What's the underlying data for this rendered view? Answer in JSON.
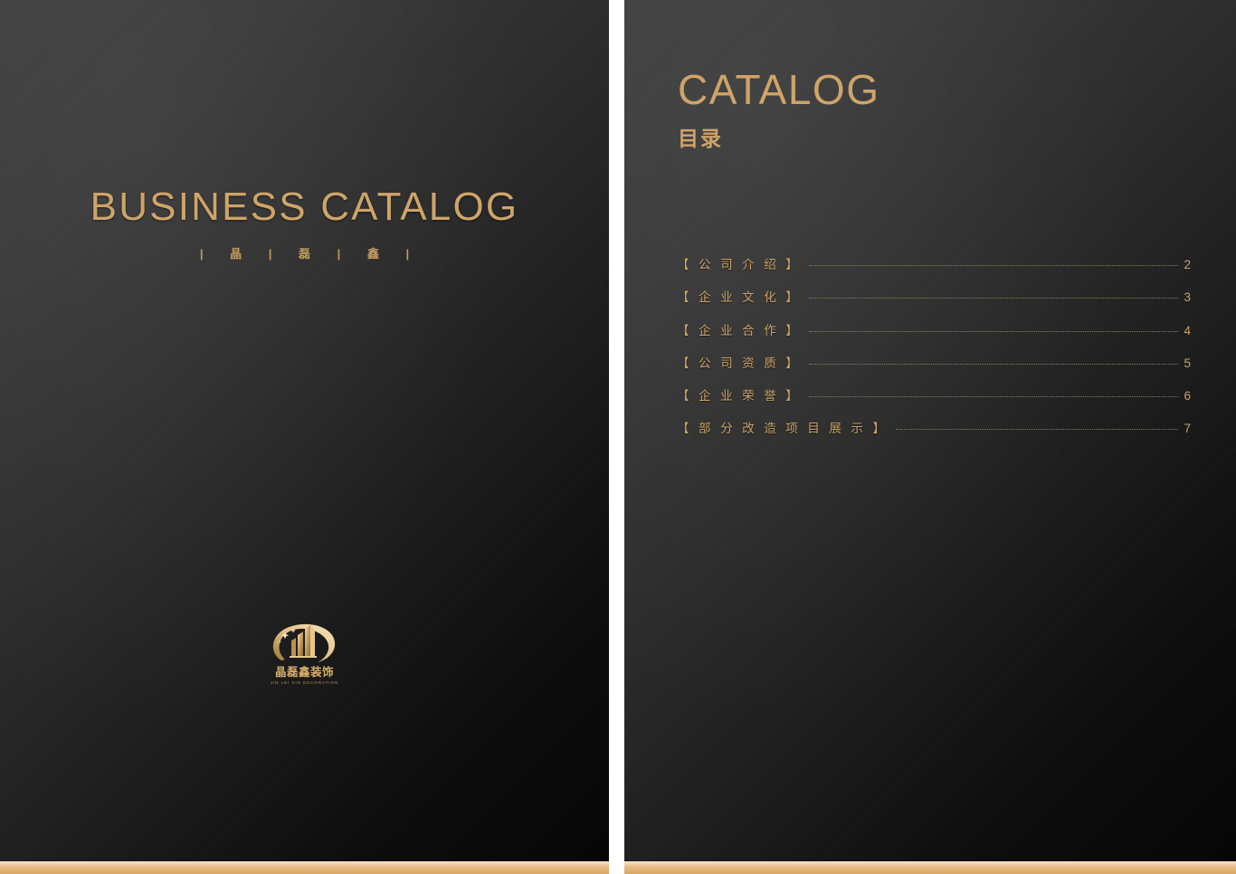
{
  "colors": {
    "gold": "#cfa469",
    "gold_dim": "#cba265",
    "dots": "#8d7a5c",
    "bar_top": "#f5ddbc",
    "bar_bottom": "#d9a768",
    "page_dark": "#060606",
    "page_light": "#3f3f3f"
  },
  "cover": {
    "title": "BUSINESS CATALOG",
    "subtitle": "| 晶 | 磊 | 鑫 |",
    "logo": {
      "icon": "building-swoosh-logo-icon",
      "name_cn": "晶磊鑫装饰",
      "name_en": "JIN LEI XIN DECORATION"
    }
  },
  "catalog": {
    "heading_en": "CATALOG",
    "heading_cn": "目录",
    "entries": [
      {
        "label": "【 公 司 介 绍 】",
        "page": "2"
      },
      {
        "label": "【 企 业 文 化 】",
        "page": "3"
      },
      {
        "label": "【 企 业 合 作 】",
        "page": "4"
      },
      {
        "label": "【 公 司 资 质 】",
        "page": "5"
      },
      {
        "label": "【 企 业 荣 誉 】",
        "page": "6"
      },
      {
        "label": "【 部 分 改 造 项 目 展 示 】",
        "page": "7"
      }
    ]
  }
}
